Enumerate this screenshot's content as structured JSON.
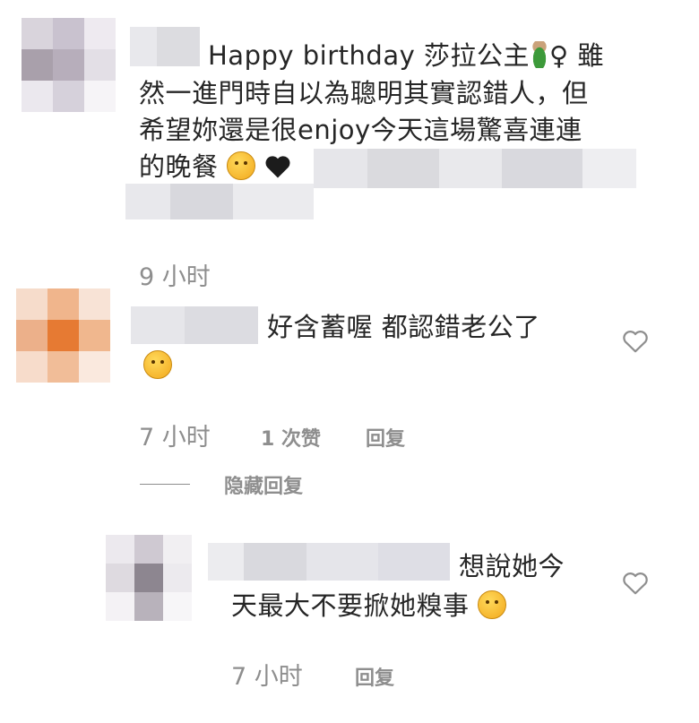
{
  "comments": [
    {
      "line1_prefix": "Happy birthday 莎拉公主",
      "line1_suffix": "♀ 雖",
      "line2": "然一進門時自以為聰明其實認錯人，但",
      "line3": "希望妳還是很enjoy今天這場驚喜連連",
      "line4": "的晚餐",
      "time": "9 小时"
    },
    {
      "text": "好含蓄喔 都認錯老公了",
      "time": "7 小时",
      "likes": "1 次赞",
      "reply": "回复",
      "hide_replies": "隐藏回复"
    },
    {
      "text_line1": "想說她今",
      "text_line2": "天最大不要掀她糗事",
      "time": "7 小时",
      "reply": "回复"
    }
  ],
  "colors": {
    "text": "#262626",
    "meta": "#8e8e8e",
    "heart_outline": "#8e8e8e"
  },
  "icons": [
    "heart-outline-icon",
    "black-heart-icon",
    "face-emoji-icon",
    "pregnant-woman-emoji-icon"
  ]
}
